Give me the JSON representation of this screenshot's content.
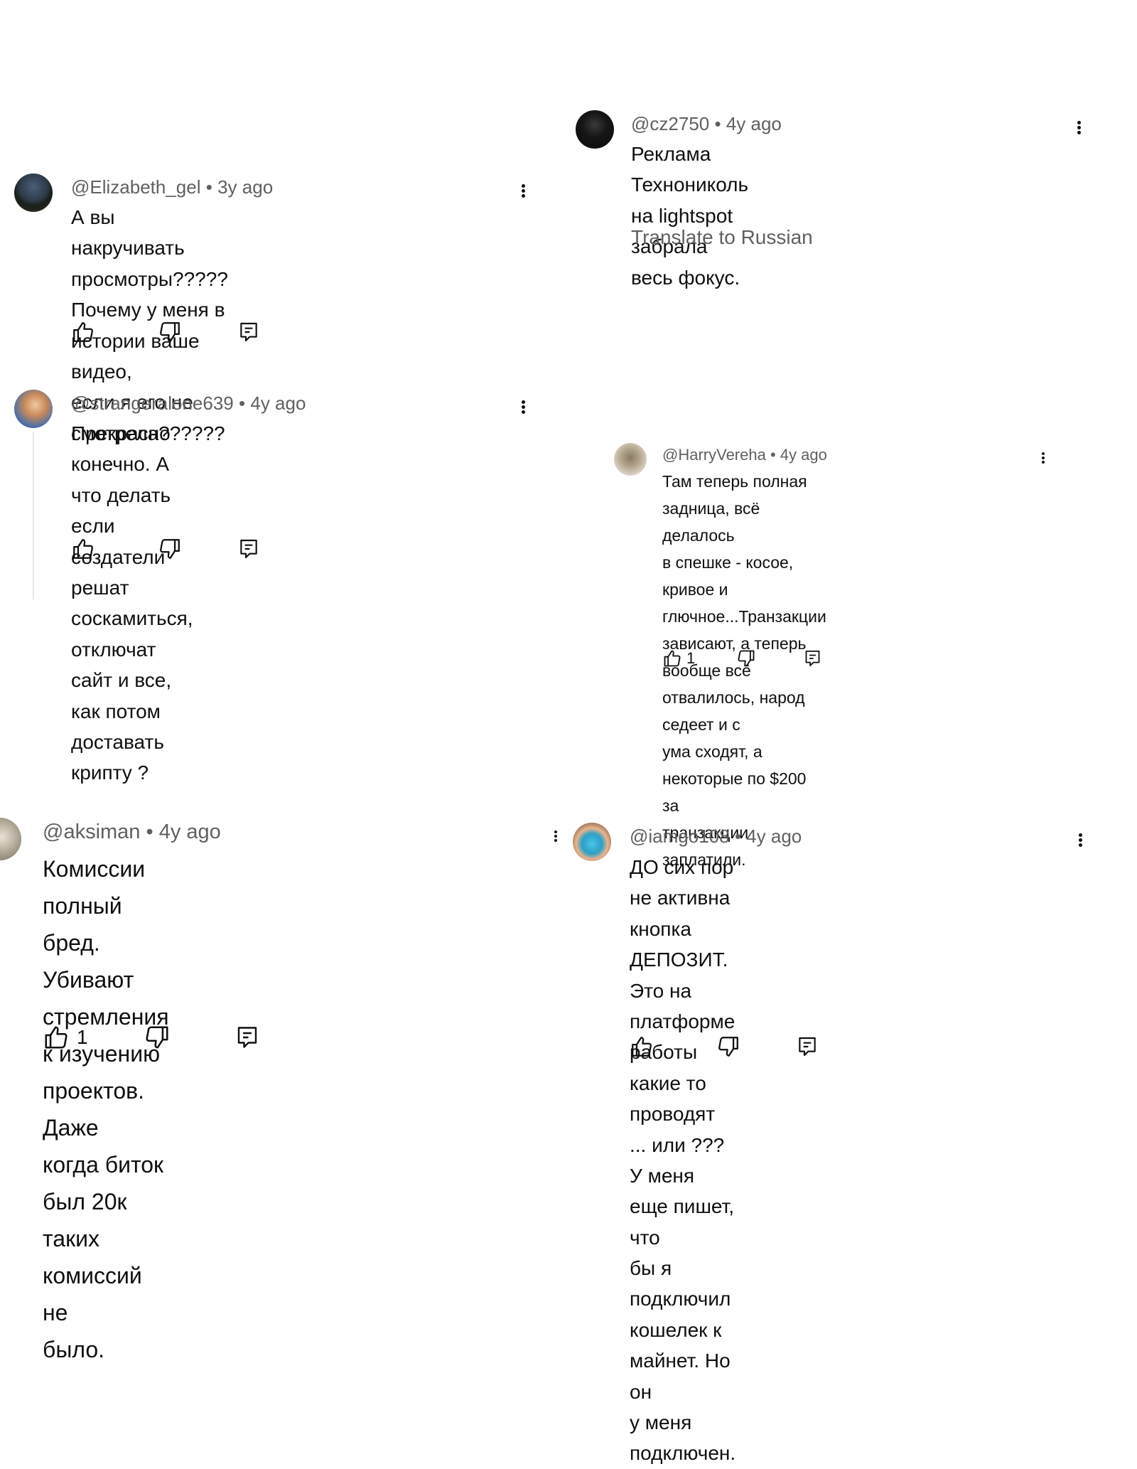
{
  "comments": [
    {
      "handle": "@Elizabeth_gel",
      "time": "3y ago",
      "text_lines": [
        "А вы накручивать просмотры?????",
        "Почему у меня в истории ваше видео,",
        "если я его не смотрела??????"
      ]
    },
    {
      "handle": "@strangeralone639",
      "time": "4y ago",
      "text_lines": [
        "Прекрасно конечно. А что делать если",
        "создатели решат соскамиться, отключат",
        "сайт и все, как потом доставать крипту ?"
      ]
    },
    {
      "handle": "@cz2750",
      "time": "4y ago",
      "text_lines": [
        "Реклама Технониколь на lightspot забрала",
        "весь фокус."
      ],
      "translate": "Translate to Russian"
    },
    {
      "handle": "@HarryVereha",
      "time": "4y ago",
      "text_lines": [
        "Там теперь полная задница, всё делалось",
        "в спешке - косое, кривое и",
        "глючное...Транзакции зависают, а теперь",
        "вообще всё отвалилось, народ седеет и с",
        "ума сходят, а некоторые по $200 за",
        "транзакции заплатили."
      ],
      "likes": "1"
    },
    {
      "handle": "@aksiman",
      "time": "4y ago",
      "text_lines": [
        "Комиссии полный бред. Убивают",
        "стремления к изучению проектов. Даже",
        "когда биток был 20к таких комиссий не",
        "было."
      ],
      "likes": "1"
    },
    {
      "handle": "@iamgo108",
      "time": "4y ago",
      "text_lines": [
        "ДО сих пор не активна кнопка ДЕПОЗИТ.",
        "Это на платформе работы какие то",
        "проводят ... или ??? У меня еще пишет, что",
        "бы я подключил кошелек к майнет. Но он",
        "у меня подключен."
      ]
    }
  ],
  "separator": "•",
  "icons": {
    "like": "thumbs-up-icon",
    "dislike": "thumbs-down-icon",
    "reply": "reply-icon",
    "more": "more-vert-icon"
  },
  "colors": {
    "text": "#0f0f0f",
    "meta": "#606060",
    "thread_line": "#e5e5e5"
  }
}
